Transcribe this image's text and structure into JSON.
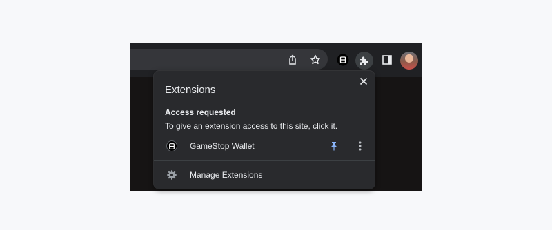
{
  "popup": {
    "title": "Extensions",
    "access_heading": "Access requested",
    "access_description": "To give an extension access to this site, click it.",
    "extensions": [
      {
        "name": "GameStop Wallet",
        "pinned": true
      }
    ],
    "manage_label": "Manage Extensions"
  },
  "colors": {
    "toolbar_bg": "#202124",
    "omnibox_bg": "#35363a",
    "popup_bg": "#292a2d",
    "text": "#e8eaed",
    "pin_accent": "#8ab4f8",
    "icon_gray": "#9aa0a6"
  },
  "icons": {
    "share": "share-icon",
    "bookmark": "star-icon",
    "extensions": "puzzle-icon",
    "side_panel": "side-panel-icon",
    "close": "close-icon",
    "pin": "pin-icon",
    "more": "more-vert-icon",
    "settings": "gear-icon"
  }
}
